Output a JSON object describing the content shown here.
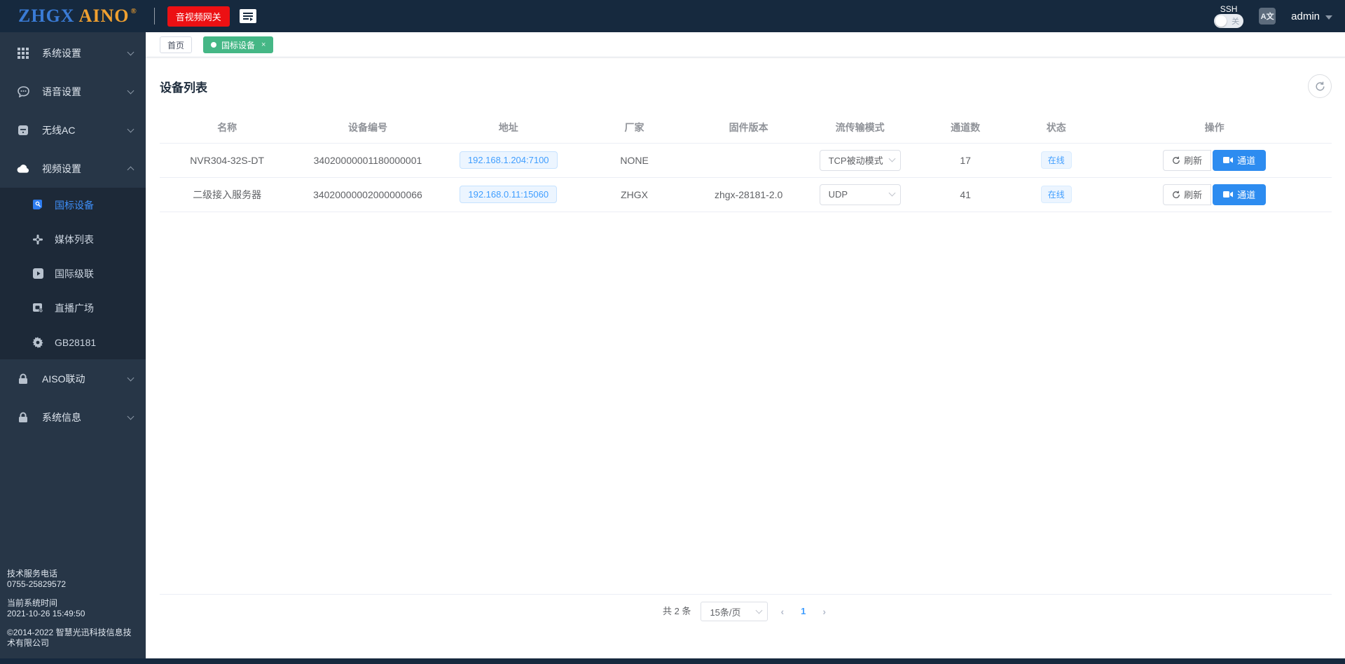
{
  "header": {
    "logo": {
      "part1": "ZHGX",
      "part2": "AINO",
      "reg": "®"
    },
    "gateway_button_label": "音视频网关",
    "ssh_label": "SSH",
    "ssh_toggle_state": "关",
    "language_icon_label": "A文",
    "username": "admin"
  },
  "sidebar": {
    "items": [
      {
        "label": "系统设置",
        "icon": "grid-icon"
      },
      {
        "label": "语音设置",
        "icon": "voice-chat-icon"
      },
      {
        "label": "无线AC",
        "icon": "wireless-ac-icon"
      },
      {
        "label": "视频设置",
        "icon": "cloud-icon",
        "expanded": true
      },
      {
        "label": "AISO联动",
        "icon": "lock-icon"
      },
      {
        "label": "系统信息",
        "icon": "lock-icon"
      }
    ],
    "video_children": [
      {
        "label": "国标设备",
        "icon": "gb-device-icon",
        "active": true
      },
      {
        "label": "媒体列表",
        "icon": "media-list-icon"
      },
      {
        "label": "国际级联",
        "icon": "cascade-icon"
      },
      {
        "label": "直播广场",
        "icon": "live-plaza-icon"
      },
      {
        "label": "GB28181",
        "icon": "gear-icon"
      }
    ],
    "footer": {
      "service_label": "技术服务电话",
      "service_phone": "0755-25829572",
      "time_label": "当前系统时间",
      "system_time": "2021-10-26 15:49:50",
      "copyright": "©2014-2022 智慧光迅科技信息技术有限公司"
    }
  },
  "tabs": {
    "home": "首页",
    "active_tab": "国标设备",
    "close": "×"
  },
  "main": {
    "title": "设备列表",
    "table": {
      "columns": [
        "名称",
        "设备编号",
        "地址",
        "厂家",
        "固件版本",
        "流传输模式",
        "通道数",
        "状态",
        "操作"
      ],
      "rows": [
        {
          "name": "NVR304-32S-DT",
          "device_id": "34020000001180000001",
          "address": "192.168.1.204:7100",
          "vendor": "NONE",
          "firmware": "",
          "stream_mode": "TCP被动模式",
          "channels": "17",
          "status": "在线"
        },
        {
          "name": "二级接入服务器",
          "device_id": "34020000002000000066",
          "address": "192.168.0.11:15060",
          "vendor": "ZHGX",
          "firmware": "zhgx-28181-2.0",
          "stream_mode": "UDP",
          "channels": "41",
          "status": "在线"
        }
      ],
      "actions": {
        "refresh": "刷新",
        "channel": "通道"
      }
    },
    "pagination": {
      "total": "共 2 条",
      "page_size": "15条/页",
      "prev": "‹",
      "current_page": "1",
      "next": "›"
    }
  },
  "colors": {
    "topbar_navy": "#16293e",
    "sidebar": "#273647",
    "submenu": "#1d2938",
    "accent_blue": "#2d8cf0",
    "link_blue": "#409eff",
    "tab_green": "#45b786",
    "gateway_red": "#ec1013"
  }
}
